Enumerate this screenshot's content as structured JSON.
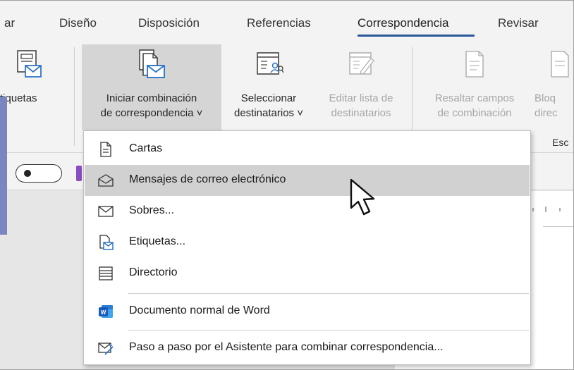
{
  "tabs": [
    {
      "label": "ar"
    },
    {
      "label": "Diseño"
    },
    {
      "label": "Disposición"
    },
    {
      "label": "Referencias"
    },
    {
      "label": "Correspondencia",
      "active": true
    },
    {
      "label": "Revisar"
    }
  ],
  "ribbon": {
    "etiquetas": {
      "label": "tiquetas"
    },
    "iniciar": {
      "line1": "Iniciar combinación",
      "line2": "de correspondencia ˅"
    },
    "seleccionar": {
      "line1": "Seleccionar",
      "line2": "destinatarios ˅"
    },
    "editar": {
      "line1": "Editar lista de",
      "line2": "destinatarios"
    },
    "resaltar": {
      "line1": "Resaltar campos",
      "line2": "de combinación"
    },
    "bloque": {
      "line1": "Bloq",
      "line2": "direc"
    },
    "group_label": "Esc"
  },
  "menu": {
    "items": [
      {
        "label": "Cartas",
        "icon": "document-icon"
      },
      {
        "label": "Mensajes de correo electrónico",
        "icon": "envelope-open-icon",
        "highlighted": true
      },
      {
        "label": "Sobres...",
        "icon": "envelope-icon"
      },
      {
        "label": "Etiquetas...",
        "icon": "labels-icon"
      },
      {
        "label": "Directorio",
        "icon": "directory-icon"
      },
      {
        "label": "Documento normal de Word",
        "icon": "word-icon"
      },
      {
        "label": "Paso a paso por el Asistente para combinar correspondencia...",
        "icon": "wizard-icon"
      }
    ]
  },
  "colors": {
    "accent": "#2b579a",
    "hover": "#d1d1d1",
    "word_blue": "#185abd"
  }
}
